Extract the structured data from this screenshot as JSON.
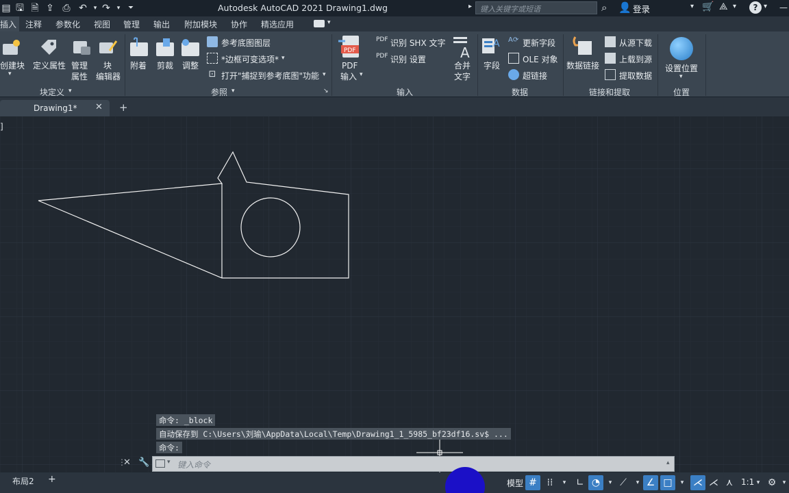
{
  "titlebar": {
    "app_title": "Autodesk AutoCAD 2021    Drawing1.dwg",
    "search_placeholder": "键入关键字或短语",
    "login": "登录"
  },
  "ribbon_tabs": [
    "插入",
    "注释",
    "参数化",
    "视图",
    "管理",
    "输出",
    "附加模块",
    "协作",
    "精选应用"
  ],
  "active_tab": "插入",
  "panels": {
    "block_def": {
      "title": "块定义",
      "create_block": "创建块",
      "define_attr": "定义属性",
      "manage_attr_1": "管理",
      "manage_attr_2": "属性",
      "block_editor_1": "块",
      "block_editor_2": "编辑器"
    },
    "reference": {
      "title": "参照",
      "attach": "附着",
      "clip": "剪裁",
      "adjust": "调整",
      "underlay_layers": "参考底图图层",
      "frame_option": "*边框可变选项*",
      "snap_underlay": "打开\"捕捉到参考底图\"功能"
    },
    "import": {
      "title": "输入",
      "pdf_import_1": "PDF",
      "pdf_import_2": "输入",
      "recognize_shx": "识别 SHX 文字",
      "recognize_settings": "识别 设置",
      "combine_text_1": "合并",
      "combine_text_2": "文字"
    },
    "data": {
      "title": "数据",
      "field": "字段",
      "update_field": "更新字段",
      "ole_object": "OLE 对象",
      "hyperlink": "超链接"
    },
    "link_extract": {
      "title": "链接和提取",
      "data_link": "数据链接",
      "download_source": "从源下载",
      "upload_source": "上载到源",
      "extract_data": "提取数据"
    },
    "location": {
      "title": "位置",
      "set_location": "设置位置"
    }
  },
  "doc_tab": "Drawing1*",
  "command_history": [
    "命令: _block",
    "自动保存到 C:\\Users\\刘瑜\\AppData\\Local\\Temp\\Drawing1_1_5985_bf23df16.sv$ ...",
    "命令:"
  ],
  "command_placeholder": "键入命令",
  "layout_tab": "布局2",
  "status": {
    "model": "模型",
    "scale": "1:1"
  },
  "colors": {
    "canvas": "#212830",
    "ribbon": "#3b4651",
    "accent": "#3b7fc4"
  }
}
